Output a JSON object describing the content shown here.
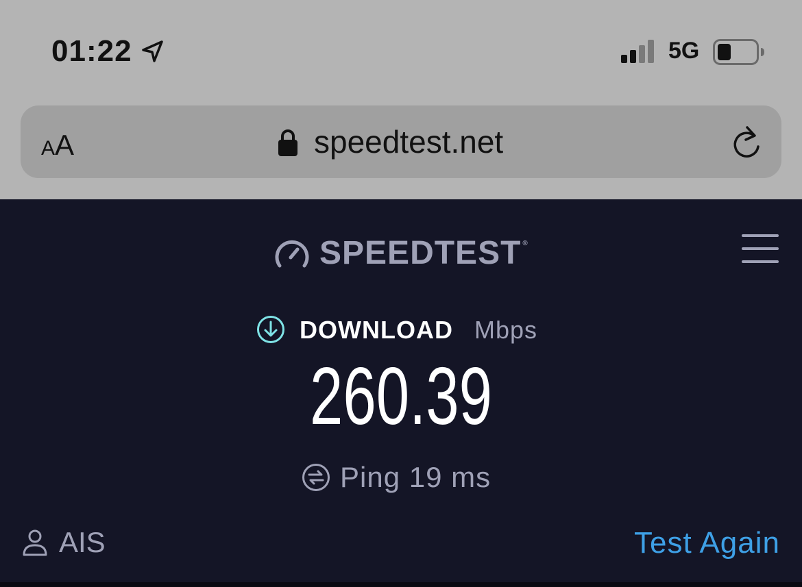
{
  "status_bar": {
    "time": "01:22",
    "network": "5G",
    "battery_level": 0.35
  },
  "browser": {
    "text_size_small": "A",
    "text_size_large": "A",
    "url": "speedtest.net"
  },
  "app": {
    "logo_text": "SPEEDTEST",
    "trademark": "®",
    "download_label": "DOWNLOAD",
    "download_unit": "Mbps",
    "download_value": "260.39",
    "ping_text": "Ping 19 ms",
    "isp_name": "AIS",
    "test_again_label": "Test Again"
  },
  "colors": {
    "accent": "#3ea0e6",
    "download_icon": "#7fe3e6",
    "background": "#141526",
    "muted_text": "#9fa1b6"
  },
  "icons": [
    "location-arrow-icon",
    "signal-bars-icon",
    "battery-icon",
    "lock-icon",
    "reload-icon",
    "speedometer-icon",
    "hamburger-menu-icon",
    "download-arrow-icon",
    "ping-icon",
    "user-icon"
  ]
}
